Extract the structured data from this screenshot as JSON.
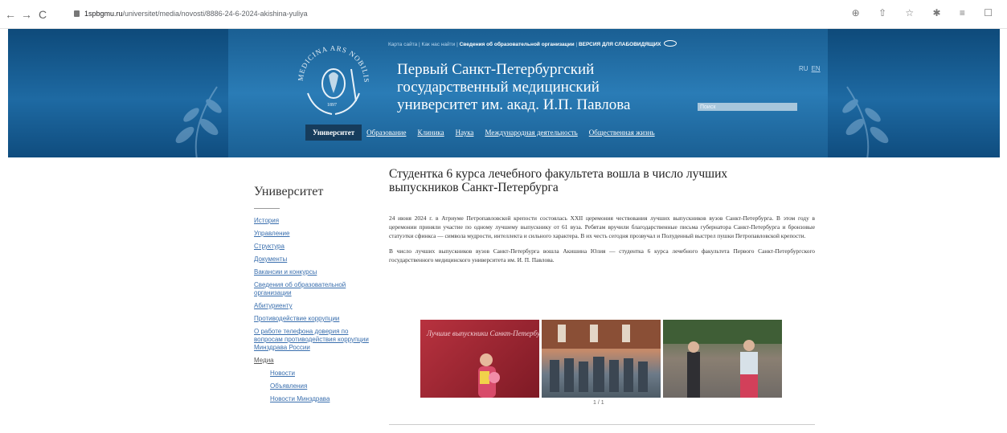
{
  "browser": {
    "url_host": "1spbgmu.ru",
    "url_path": "/universitet/media/novosti/8886-24-6-2024-akishina-yuliya",
    "back": "←",
    "forward": "→",
    "reload": "C",
    "tools": "⊕ ⇧ ☆ ✱ ≡ ☐"
  },
  "header": {
    "top_links": [
      "Карта сайта",
      "Как нас найти",
      "Сведения об образовательной организации"
    ],
    "vision_link": "ВЕРСИЯ ДЛЯ СЛАБОВИДЯЩИХ",
    "lang_ru": "RU",
    "lang_en": "EN",
    "title_line1": "Первый Санкт-Петербургский",
    "title_line2": "государственный медицинский",
    "title_line3": "университет им. акад. И.П. Павлова",
    "search_placeholder": "Поиск",
    "emblem_text": "MEDICINA ARS NOBILISSIMA",
    "emblem_year": "1897",
    "menu": [
      {
        "label": "Университет",
        "active": true
      },
      {
        "label": "Образование"
      },
      {
        "label": "Клиника"
      },
      {
        "label": "Наука"
      },
      {
        "label": "Международная деятельность"
      },
      {
        "label": "Общественная жизнь"
      }
    ]
  },
  "sidebar": {
    "title": "Университет",
    "items": [
      "История",
      "Управление",
      "Структура",
      "Документы",
      "Вакансии и конкурсы",
      "Сведения об образовательной организации",
      "Абитуриенту",
      "Противодействие коррупции",
      "О работе телефона доверия по вопросам противодействия коррупции Минздрава России",
      "Медиа"
    ],
    "subitems": [
      "Новости",
      "Объявления",
      "Новости Минздрава"
    ]
  },
  "article": {
    "title": "Студентка 6 курса лечебного факультета вошла в число лучших выпускников Санкт-Петербурга",
    "para1": "24 июня 2024 г. в Атриуме Петропавловской крепости состоялась XXII церемония чествования лучших выпускников вузов Санкт-Петербурга. В этом году в церемонии приняли участие по одному лучшему выпускнику от 61 вуза. Ребятам вручили благодарственные письма губернатора Санкт-Петербурга и бронзовые статуэтки сфинкса — символа мудрости, интеллекта и сильного характера. В их честь сегодня прозвучал и Полуденный выстрел пушки Петропавловской крепости.",
    "para2": "В число лучших выпускников вузов Санкт-Петербурга вошла Акишина Юлия — студентка 6 курса лечебного факультета Первого Санкт-Петербургского государственного медицинского университета им. И. П. Павлова.",
    "photo_caption": "Лучшие выпускники Санкт-Петербурга",
    "gallery_counter": "1 / 1"
  }
}
